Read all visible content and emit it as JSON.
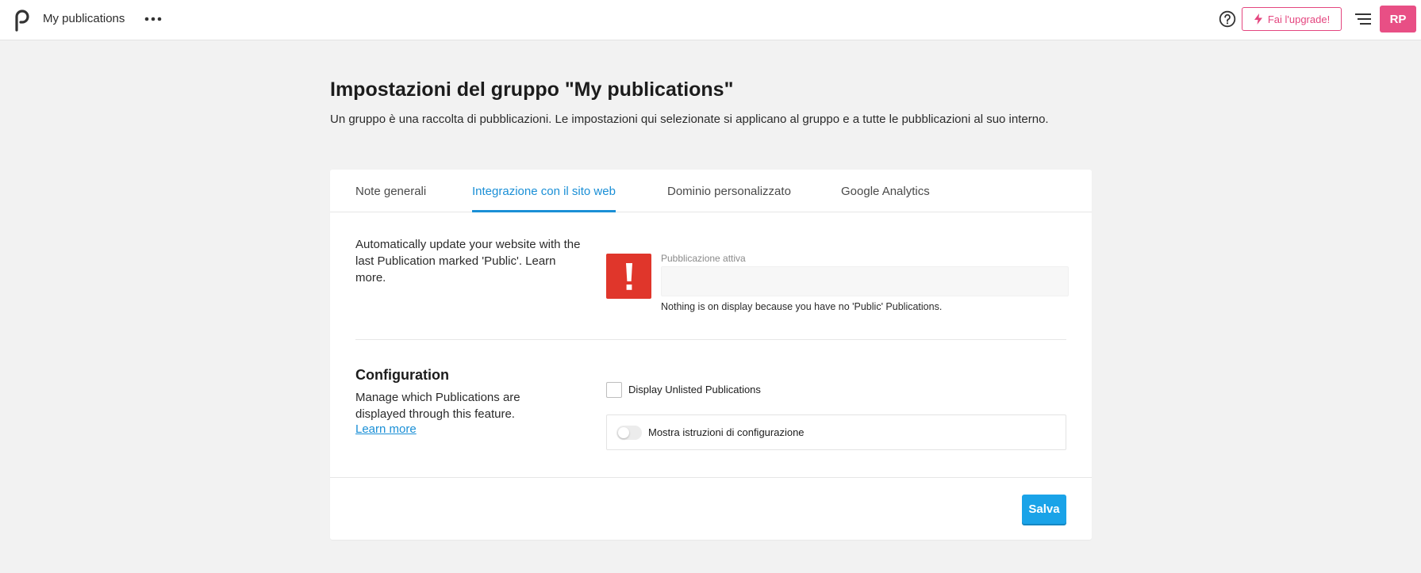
{
  "header": {
    "app_title": "My publications",
    "upgrade_label": "Fai l'upgrade!",
    "avatar_initials": "RP",
    "colors": {
      "accent_pink": "#e84f85",
      "accent_blue": "#1a8fd6"
    }
  },
  "page": {
    "title": "Impostazioni del gruppo \"My publications\"",
    "description": "Un gruppo è una raccolta di pubblicazioni. Le impostazioni qui selezionate si applicano al gruppo e a tutte le pubblicazioni al suo interno."
  },
  "tabs": [
    {
      "label": "Note generali",
      "active": false
    },
    {
      "label": "Integrazione con il sito web",
      "active": true
    },
    {
      "label": "Dominio personalizzato",
      "active": false
    },
    {
      "label": "Google Analytics",
      "active": false
    }
  ],
  "integration": {
    "description": "Automatically update your website with the last Publication marked 'Public'. Learn more.",
    "active_label": "Pubblicazione attiva",
    "active_value": "",
    "note": "Nothing is on display because you have no 'Public' Publications."
  },
  "configuration": {
    "title": "Configuration",
    "description": "Manage which Publications are displayed through this feature.",
    "learn_more": "Learn more",
    "checkbox_label": "Display Unlisted Publications",
    "checkbox_checked": false,
    "toggle_label": "Mostra istruzioni di configurazione",
    "toggle_on": false
  },
  "footer": {
    "save_label": "Salva"
  }
}
